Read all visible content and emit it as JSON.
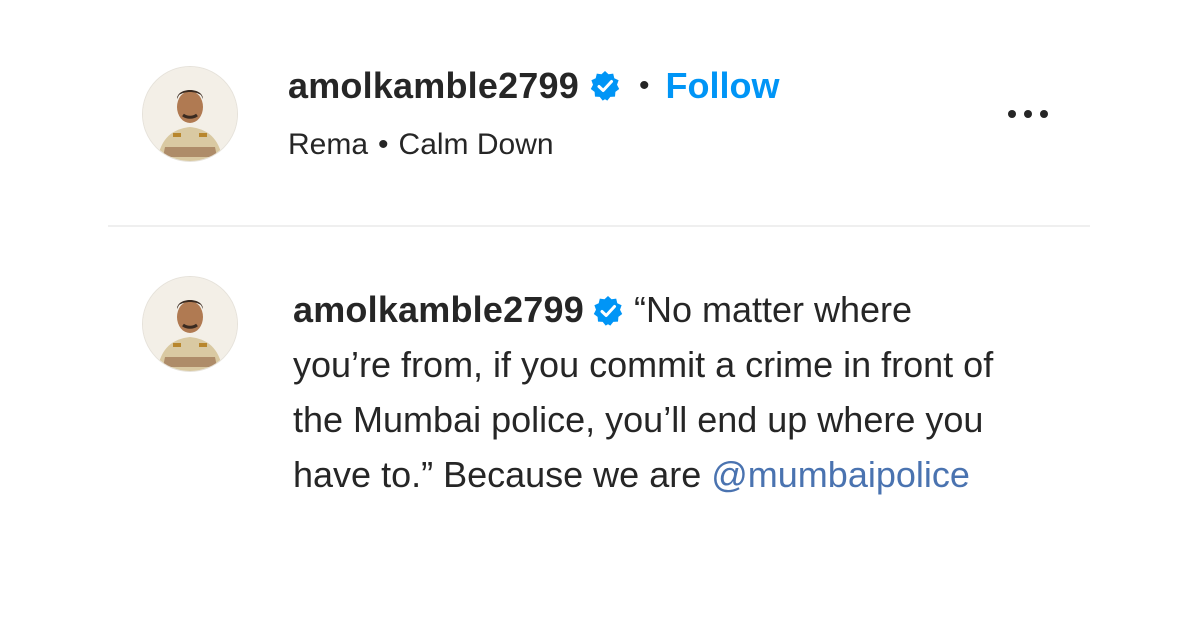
{
  "post_header": {
    "username": "amolkamble2799",
    "verified": true,
    "separator": "•",
    "follow_label": "Follow",
    "audio": {
      "artist": "Rema",
      "separator": "•",
      "track": "Calm Down"
    },
    "more_icon": "more-horizontal-icon"
  },
  "caption": {
    "username": "amolkamble2799",
    "verified": true,
    "text": "“No matter where you’re from, if you commit a crime in front of the Mumbai police, you’ll end up where you have to.” Because we are ",
    "mention": "@mumbaipolice"
  },
  "colors": {
    "follow": "#0095f6",
    "verified_badge": "#0095f6",
    "mention": "#4a73b0",
    "text": "#262626",
    "divider": "#efefef"
  }
}
